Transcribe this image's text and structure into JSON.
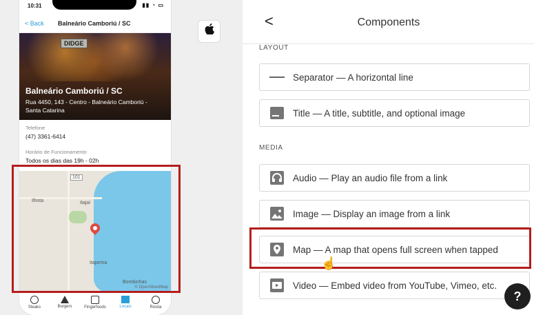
{
  "preview": {
    "status_time": "10:31",
    "status_icons": "▮▮ ◔ ▭",
    "nav_back": "< Back",
    "nav_title": "Balneário Camboriú / SC",
    "hero_sign": "DIDGE",
    "place_name": "Balneário Camboriú / SC",
    "place_address": "Rua 4450, 143 - Centro - Balneário Camboriú - Santa Catarina",
    "phone_label": "Telefone",
    "phone_value": "(47) 3361-6414",
    "hours_label": "Horário de Funcionamento",
    "hours_value": "Todos os dias das 19h - 02h",
    "map_labels": {
      "itajai": "Itajaí",
      "ilhota": "Ilhota",
      "itapema": "Itapema",
      "bombinhas": "Bombinhas",
      "road": "101",
      "attribution": "© OpenStreetMap"
    },
    "tabs": [
      {
        "label": "Steaks",
        "icon": "circle-icon"
      },
      {
        "label": "Burgers",
        "icon": "triangle-icon"
      },
      {
        "label": "Fingerfoods",
        "icon": "square-icon"
      },
      {
        "label": "Locais",
        "icon": "triangle-icon",
        "active": true
      },
      {
        "label": "Rosita",
        "icon": "circle-icon"
      }
    ]
  },
  "apple_icon": "",
  "panel": {
    "back_icon": "<",
    "title": "Components",
    "section_layout": "LAYOUT",
    "section_media": "MEDIA",
    "items": [
      {
        "icon": "separator-icon",
        "label": "Separator — A horizontal line"
      },
      {
        "icon": "title-icon",
        "label": "Title — A title, subtitle, and optional image"
      },
      {
        "icon": "headphones-icon",
        "label": "Audio — Play an audio file from a link"
      },
      {
        "icon": "image-icon",
        "label": "Image — Display an image from a link"
      },
      {
        "icon": "map-pin-icon",
        "label": "Map — A map that opens full screen when tapped"
      },
      {
        "icon": "video-play-icon",
        "label": "Video — Embed video from YouTube, Vimeo, etc."
      }
    ],
    "help_label": "?"
  },
  "colors": {
    "highlight": "#b51d1d",
    "accent": "#2a9fd6",
    "map_sea": "#7ac7ea",
    "pin": "#e04a3f"
  }
}
